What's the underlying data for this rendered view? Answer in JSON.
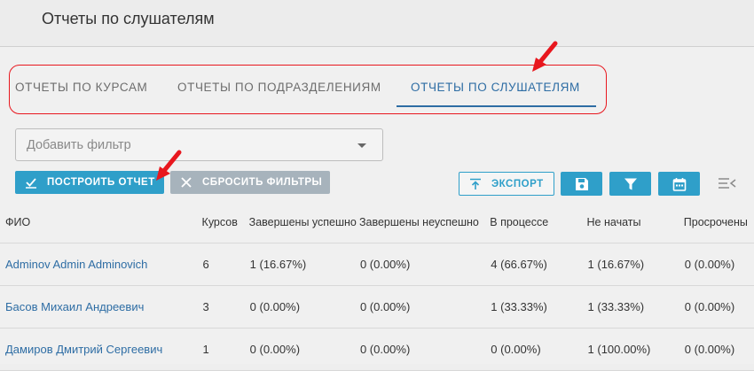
{
  "header": {
    "title": "Отчеты по слушателям"
  },
  "tabs": [
    {
      "label": "ОТЧЕТЫ ПО КУРСАМ",
      "active": false
    },
    {
      "label": "ОТЧЕТЫ ПО ПОДРАЗДЕЛЕНИЯМ",
      "active": false
    },
    {
      "label": "ОТЧЕТЫ ПО СЛУШАТЕЛЯМ",
      "active": true
    }
  ],
  "filter": {
    "placeholder": "Добавить фильтр"
  },
  "buttons": {
    "build": "ПОСТРОИТЬ ОТЧЕТ",
    "reset": "СБРОСИТЬ ФИЛЬТРЫ",
    "export": "ЭКСПОРТ"
  },
  "colors": {
    "accent": "#2f9fc9",
    "link": "#2e6da4",
    "annotation": "#e8171e",
    "secondary": "#a7b3bc"
  },
  "table": {
    "columns": [
      "ФИО",
      "Курсов",
      "Завершены успешно",
      "Завершены неуспешно",
      "В процессе",
      "Не начаты",
      "Просрочены"
    ],
    "rows": [
      {
        "name": "Adminov Admin Adminovich",
        "courses": "6",
        "success": "1 (16.67%)",
        "failed": "0 (0.00%)",
        "in_progress": "4 (66.67%)",
        "not_started": "1 (16.67%)",
        "overdue": "0 (0.00%)"
      },
      {
        "name": "Басов Михаил Андреевич",
        "courses": "3",
        "success": "0 (0.00%)",
        "failed": "0 (0.00%)",
        "in_progress": "1 (33.33%)",
        "not_started": "1 (33.33%)",
        "overdue": "0 (0.00%)"
      },
      {
        "name": "Дамиров Дмитрий Сергеевич",
        "courses": "1",
        "success": "0 (0.00%)",
        "failed": "0 (0.00%)",
        "in_progress": "0 (0.00%)",
        "not_started": "1 (100.00%)",
        "overdue": "0 (0.00%)"
      }
    ]
  }
}
